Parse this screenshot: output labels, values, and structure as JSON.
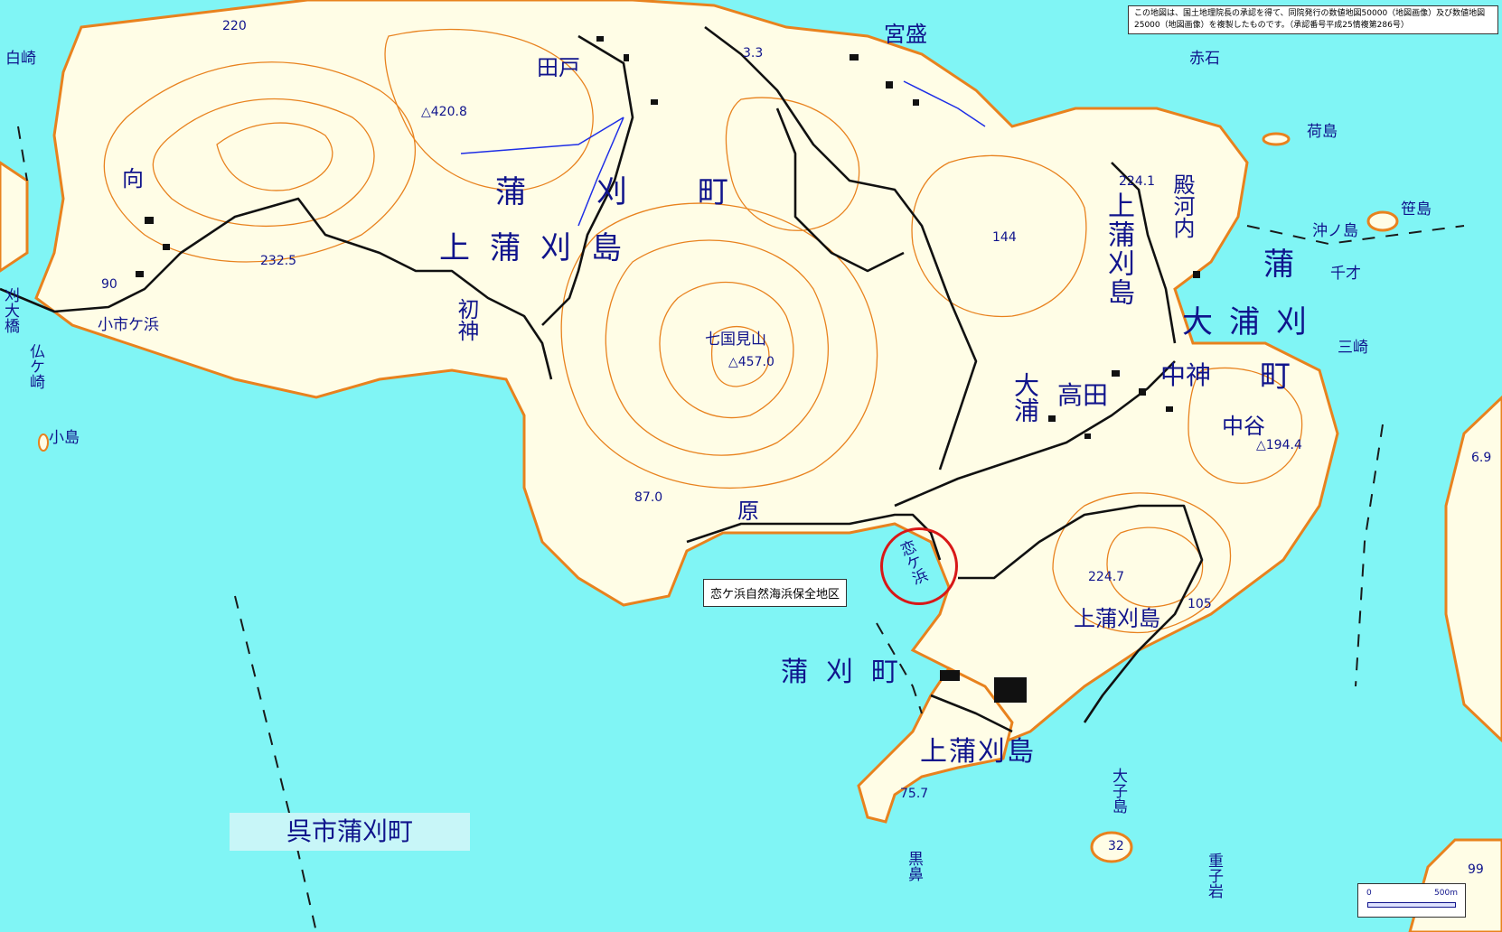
{
  "notice": "この地図は、国土地理院長の承認を得て、同院発行の数値地図50000（地図画像）及び数値地図25000（地図画像）を複製したものです。（承認番号平成25情複第286号）",
  "map_title": "呉市蒲刈町",
  "callout": "恋ケ浜自然海浜保全地区",
  "highlight_label": "恋ケ浜",
  "scale": {
    "zero": "0",
    "max": "500m"
  },
  "places": {
    "kamikamagari_main": "上蒲刈島",
    "kamagari_cho_n": "蒲刈町",
    "kamagari_cho_s": "蒲刈町",
    "kamikamagari_v": "上蒲刈島",
    "kamikamagari_se": "上蒲刈島",
    "kamikamagari_s": "上蒲刈島",
    "kamagari_e": "蒲",
    "oura_kamagari": "大浦刈",
    "machi_e": "町",
    "tado": "田戸",
    "miyamori": "宮盛",
    "mukai": "向",
    "shirosaki": "白崎",
    "akaishi": "赤石",
    "nishima": "荷島",
    "sasajima": "笹島",
    "okinoshima": "沖ノ島",
    "senzai": "千才",
    "misaki": "三崎",
    "tonogouchi": "殿河内",
    "hatsugami": "初神",
    "nanakunimiyama": "七国見山",
    "koichigahama": "小市ケ浜",
    "hotokegasaki": "仏ケ崎",
    "kojima": "小島",
    "oura": "大浦",
    "takata": "高田",
    "nakagami": "中神",
    "nakatani": "中谷",
    "hara": "原",
    "kurobana": "黒鼻",
    "okojima": "大子島",
    "jushiiwa": "重子岩",
    "bridge": "刈大橋"
  },
  "elevations": {
    "e220": "220",
    "e420": "△420.8",
    "e33": "3.3",
    "e2325": "232.5",
    "e90": "90",
    "e457": "△457.0",
    "e2241": "224.1",
    "e144": "144",
    "e1944": "△194.4",
    "e870": "87.0",
    "e2247": "224.7",
    "e105": "105",
    "e757": "75.7",
    "e32": "32",
    "e69": "6.9",
    "e99": "99"
  },
  "colors": {
    "sea": "#80f5f5",
    "land": "#fffde6",
    "contour": "#e8821e",
    "label": "#10148c",
    "road": "#111111",
    "highlight": "#d81818"
  }
}
